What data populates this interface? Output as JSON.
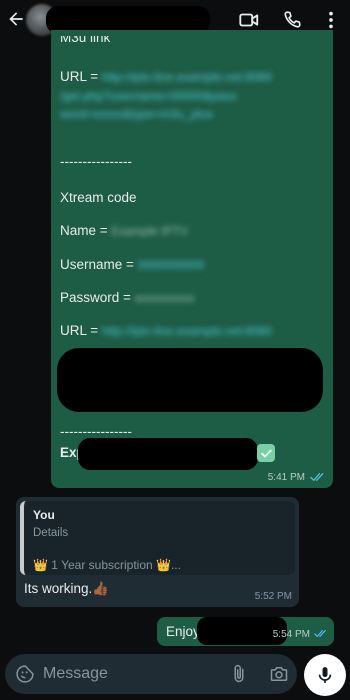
{
  "colors": {
    "background": "#0b0d0e",
    "outgoing_bubble": "#1d5c45",
    "incoming_bubble": "#202c33",
    "link": "#52c9d8",
    "tick": "#53bdeb",
    "check": "#7ad0a6"
  },
  "header": {
    "back_icon": "arrow-left-icon",
    "video_icon": "video-camera-icon",
    "call_icon": "phone-icon",
    "menu_icon": "vertical-dots-icon"
  },
  "messages": {
    "outgoing_main": {
      "m3u_label": "M3u link",
      "url1_label": "URL = ",
      "url1_value_lines": [
        "http://iptv-line.example.net:8080",
        "/get.php?username=00000&pass",
        "word=xxxxx&type=m3u_plus"
      ],
      "divider1": "----------------",
      "xtream_title": "Xtream code",
      "name_label": "Name = ",
      "name_value": "Example IPTV",
      "username_label": "Username = ",
      "username_value": "0000000000",
      "password_label": "Password = ",
      "password_value": "xxxxxxxxxx",
      "url2_label": "URL = ",
      "url2_value": "http://iptv-line.example.net:8080",
      "divider2": "----------------",
      "expiry_label": "Exp",
      "time": "5:41 PM"
    },
    "incoming": {
      "quote_author": "You",
      "quote_subtitle": "Details",
      "quote_text": "👑 1 Year subscription 👑...",
      "text": "Its working.👍🏾",
      "time": "5:52 PM"
    },
    "outgoing_last": {
      "text": "Enjoy",
      "time": "5:54 PM"
    }
  },
  "composer": {
    "placeholder": "Message",
    "emoji_icon": "sticker-emoji-icon",
    "attach_icon": "paperclip-icon",
    "camera_icon": "camera-icon",
    "mic_icon": "microphone-icon"
  }
}
